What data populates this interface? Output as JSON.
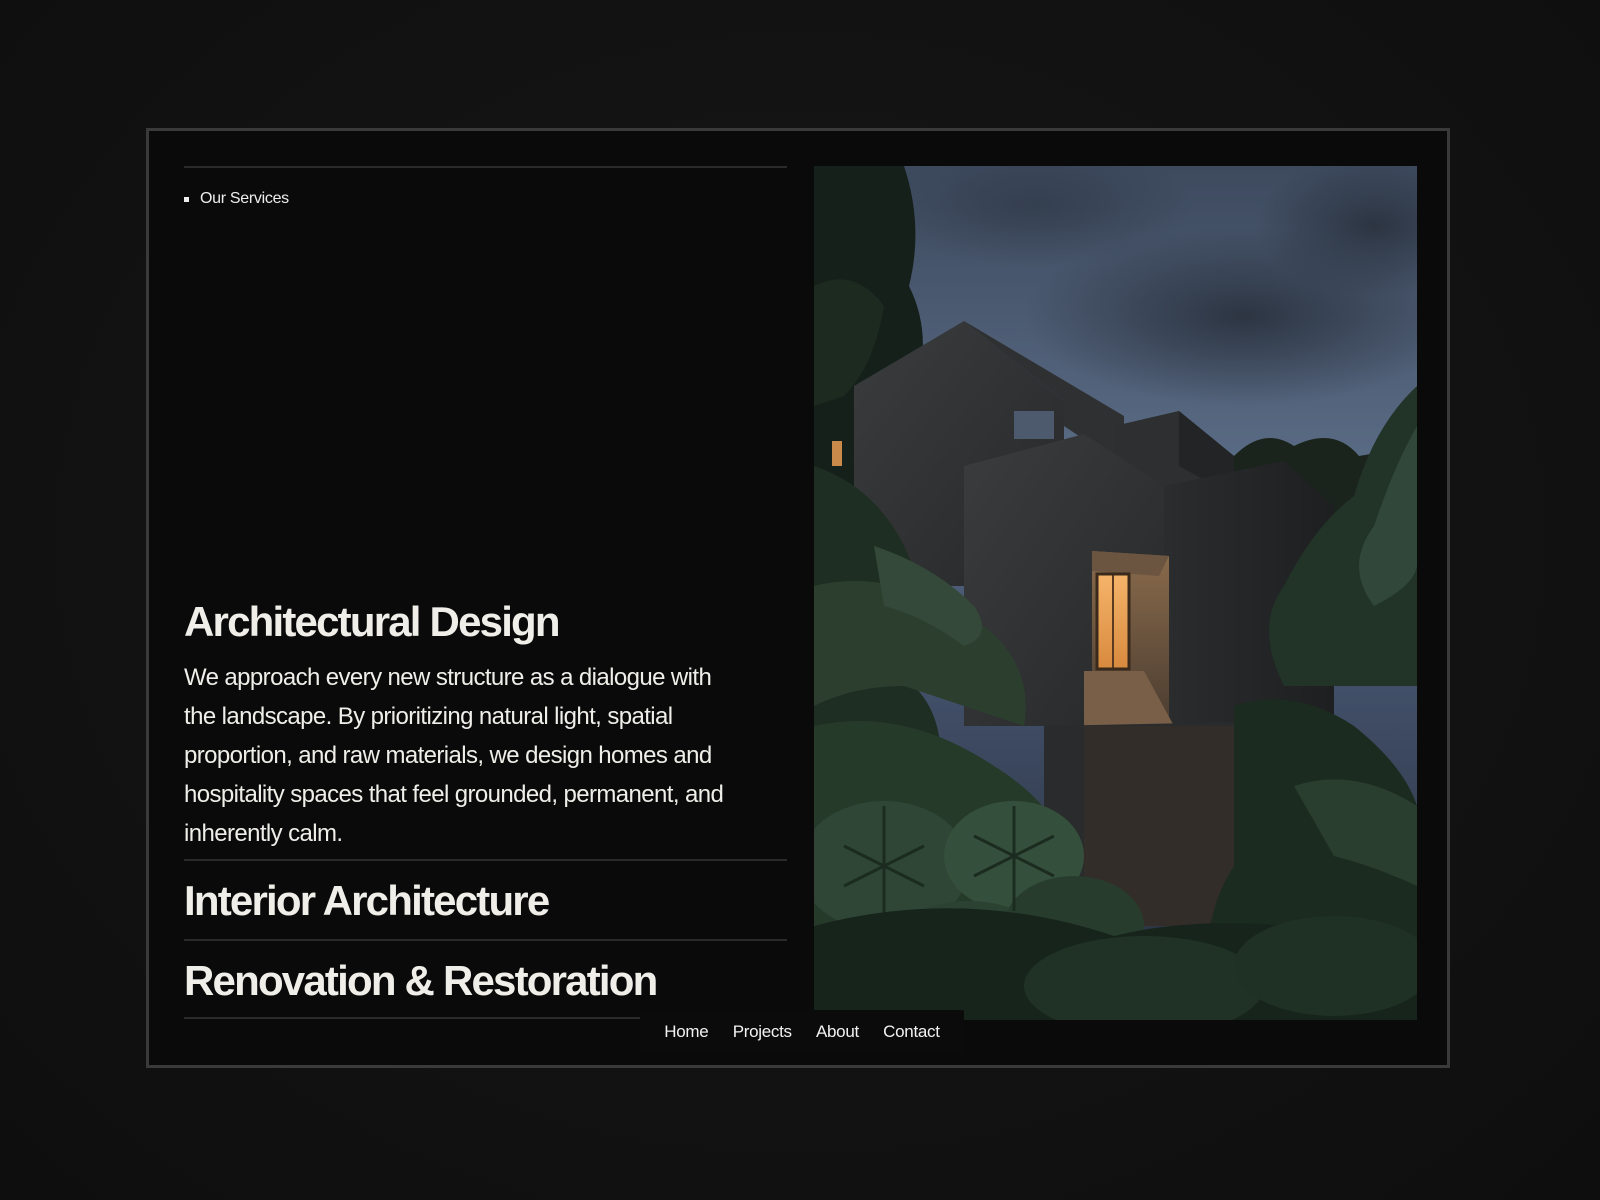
{
  "services": {
    "eyebrow": "Our Services",
    "active": {
      "title": "Architectural Design",
      "description": "We approach every new structure as a dialogue with the landscape. By prioritizing natural light, spatial proportion, and raw materials, we design homes and hospitality spaces that feel grounded, permanent, and inherently calm."
    },
    "items": [
      {
        "title": "Interior Architecture"
      },
      {
        "title": "Renovation & Restoration"
      }
    ]
  },
  "nav": {
    "items": [
      {
        "label": "Home"
      },
      {
        "label": "Projects"
      },
      {
        "label": "About"
      },
      {
        "label": "Contact"
      }
    ]
  },
  "colors": {
    "background": "#121212",
    "panel": "#0a0a0a",
    "frame_border": "#3a3a3a",
    "text": "#efeee9",
    "rule": "#2a2a2a",
    "window_glow": "#e8a25a"
  }
}
